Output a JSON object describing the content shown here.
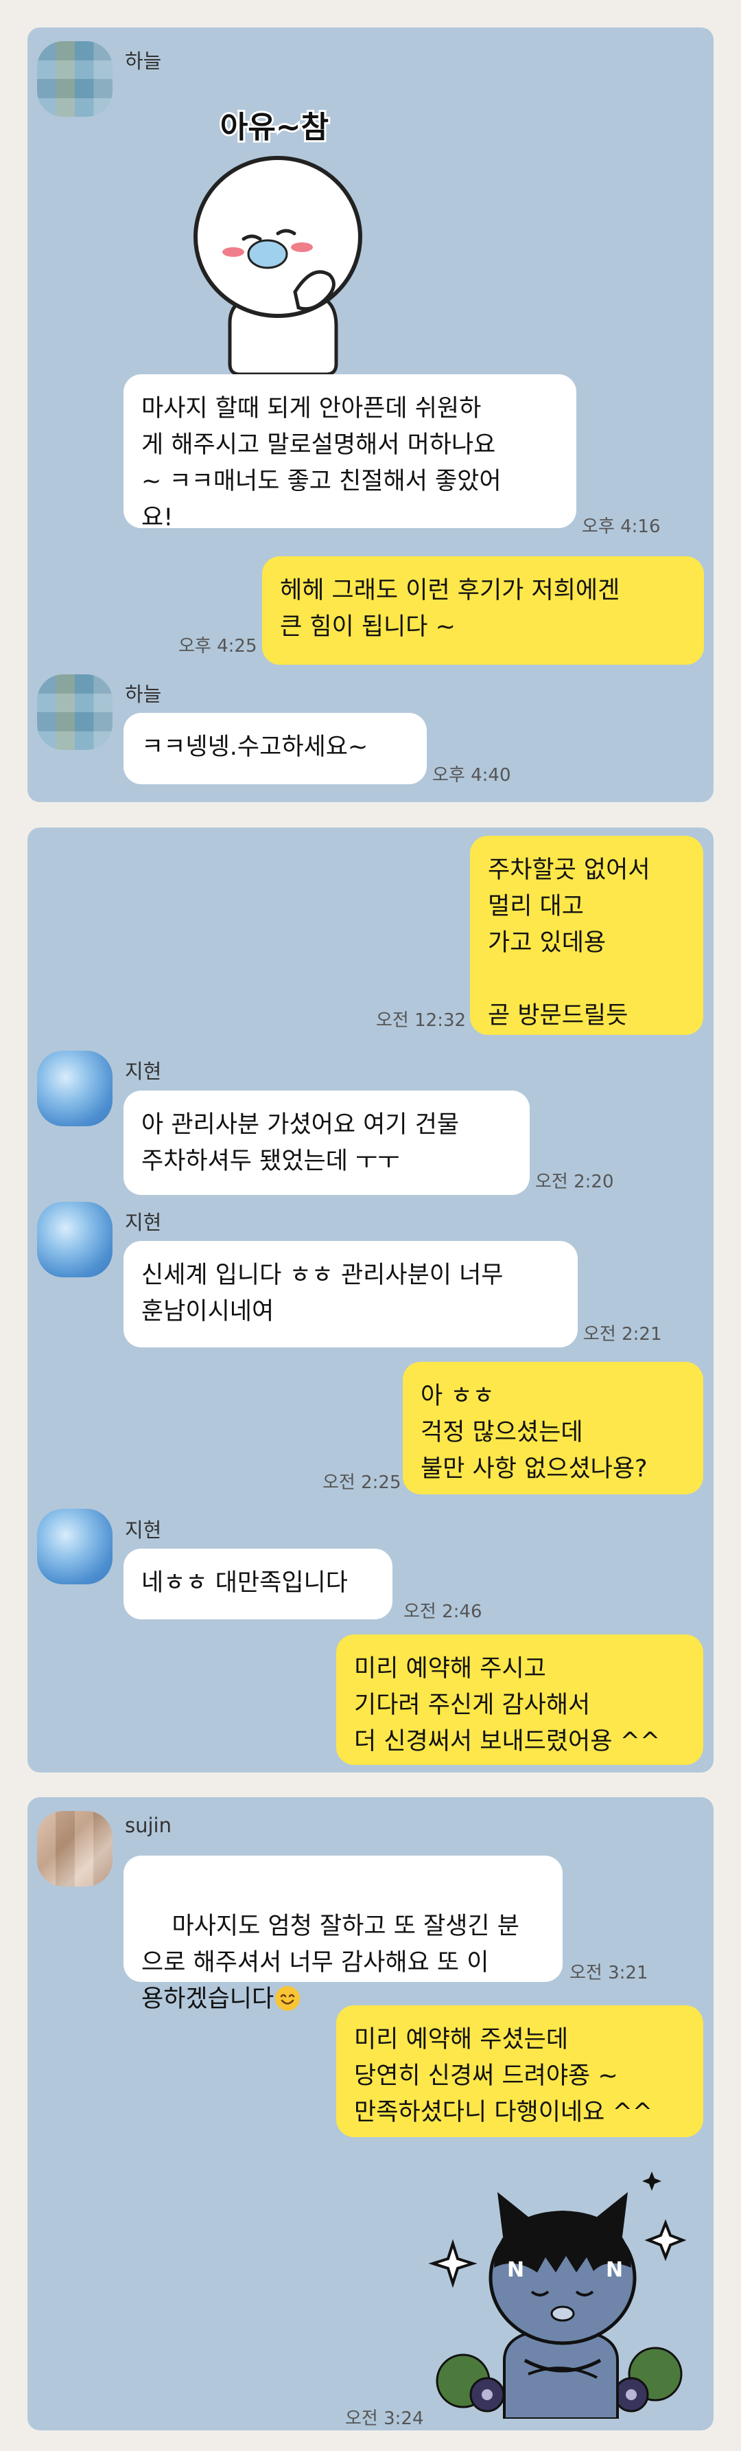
{
  "panels": [
    {
      "messages": [
        {
          "sender": "하늘",
          "type": "sticker",
          "sticker_text": "아유~참"
        },
        {
          "type": "text",
          "direction": "in",
          "text": "마사지 할때 되게 안아픈데 쉬원하\n게 해주시고 말로설명해서 머하나요\n~ ㅋㅋ매너도 좋고 친절해서 좋았어\n요!",
          "time": "오후 4:16"
        },
        {
          "type": "text",
          "direction": "out",
          "text": "헤헤 그래도 이런 후기가 저희에겐\n큰 힘이 됩니다 ~",
          "time": "오후 4:25"
        },
        {
          "sender": "하늘",
          "type": "text",
          "direction": "in",
          "text": "ㅋㅋ넹넹.수고하세요~",
          "time": "오후 4:40"
        }
      ]
    },
    {
      "messages": [
        {
          "type": "text",
          "direction": "out",
          "text": "주차할곳 없어서\n멀리 대고\n가고 있데용\n\n곧 방문드릴듯",
          "time": "오전 12:32"
        },
        {
          "sender": "지현",
          "type": "text",
          "direction": "in",
          "text": "아 관리사분 가셨어요 여기 건물\n주차하셔두 됐었는데 ㅜㅜ",
          "time": "오전 2:20"
        },
        {
          "sender": "지현",
          "type": "text",
          "direction": "in",
          "text": "신세계 입니다 ㅎㅎ 관리사분이 너무\n훈남이시네여",
          "time": "오전 2:21"
        },
        {
          "type": "text",
          "direction": "out",
          "text": "아 ㅎㅎ\n걱정 많으셨는데\n불만 사항 없으셨나용?",
          "time": "오전 2:25"
        },
        {
          "sender": "지현",
          "type": "text",
          "direction": "in",
          "text": "네ㅎㅎ 대만족입니다",
          "time": "오전 2:46"
        },
        {
          "type": "text",
          "direction": "out",
          "text": "미리 예약해 주시고\n기다려 주신게 감사해서\n더 신경써서 보내드렸어용 ^^",
          "time": ""
        }
      ]
    },
    {
      "messages": [
        {
          "sender": "sujin",
          "type": "text",
          "direction": "in",
          "text": "마사지도 엄청 잘하고 또 잘생긴 분\n으로 해주셔서 너무 감사해요 또 이\n용하겠습니다",
          "emoji": "😊",
          "time": "오전 3:21"
        },
        {
          "type": "text",
          "direction": "out",
          "text": "미리 예약해 주셨는데\n당연히 신경써 드려야죵 ~\n만족하셨다니 다행이네요 ^^"
        },
        {
          "type": "sticker",
          "direction": "out",
          "sticker_text": "N",
          "time": "오전 3:24"
        }
      ]
    }
  ],
  "colors": {
    "page_bg": "#f1eeea",
    "chat_bg": "#b2c7da",
    "bubble_in": "#ffffff",
    "bubble_out": "#fde74a",
    "time_text": "#555555"
  }
}
